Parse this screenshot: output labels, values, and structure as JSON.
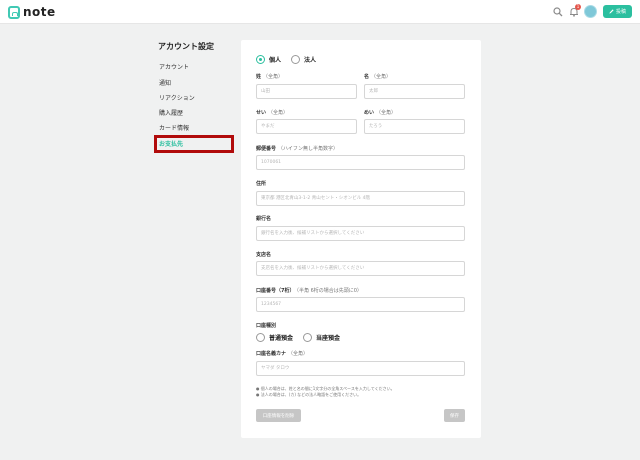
{
  "header": {
    "logo_text": "note",
    "bell_count": "1",
    "post_label": "投稿"
  },
  "sidebar": {
    "title": "アカウント設定",
    "items": [
      {
        "label": "アカウント"
      },
      {
        "label": "通知"
      },
      {
        "label": "リアクション"
      },
      {
        "label": "購入履歴"
      },
      {
        "label": "カード情報"
      },
      {
        "label": "お支払先"
      }
    ],
    "active_index": 5
  },
  "form": {
    "type_options": [
      {
        "label": "個人",
        "selected": true
      },
      {
        "label": "法人",
        "selected": false
      }
    ],
    "last_name": {
      "label": "姓",
      "note": "（全角）",
      "placeholder": "山田"
    },
    "first_name": {
      "label": "名",
      "note": "（全角）",
      "placeholder": "太郎"
    },
    "last_kana": {
      "label": "せい",
      "note": "（全角）",
      "placeholder": "やまだ"
    },
    "first_kana": {
      "label": "めい",
      "note": "（全角）",
      "placeholder": "たろう"
    },
    "postal": {
      "label": "郵便番号",
      "note": "（ハイフン無し半角数字）",
      "placeholder": "1070061"
    },
    "address": {
      "label": "住所",
      "placeholder": "東京都 港区北青山3-1-2 青山セント・シオンビル 4階"
    },
    "bank": {
      "label": "銀行名",
      "placeholder": "銀行名を入力後、候補リストから選択してください"
    },
    "branch": {
      "label": "支店名",
      "placeholder": "支店名を入力後、候補リストから選択してください"
    },
    "account_no": {
      "label": "口座番号（7桁）",
      "note": "（半角 6桁の場合は先頭に0）",
      "placeholder": "1234567"
    },
    "account_type": {
      "label": "口座種別",
      "options": [
        {
          "label": "普通預金",
          "selected": false
        },
        {
          "label": "当座預金",
          "selected": false
        }
      ]
    },
    "account_holder": {
      "label": "口座名義カナ",
      "note": "（全角）",
      "placeholder": "ヤマダ タロウ"
    },
    "notes": [
      "● 個人の場合は、姓と名の間に1文字分の全角スペースを入力してください。",
      "● 法人の場合は、(カ) などの法人略語をご使用ください。"
    ],
    "delete_button": "口座情報を削除",
    "save_button": "保存"
  },
  "colors": {
    "accent": "#2bbf9f",
    "highlight": "#b10b0b"
  }
}
